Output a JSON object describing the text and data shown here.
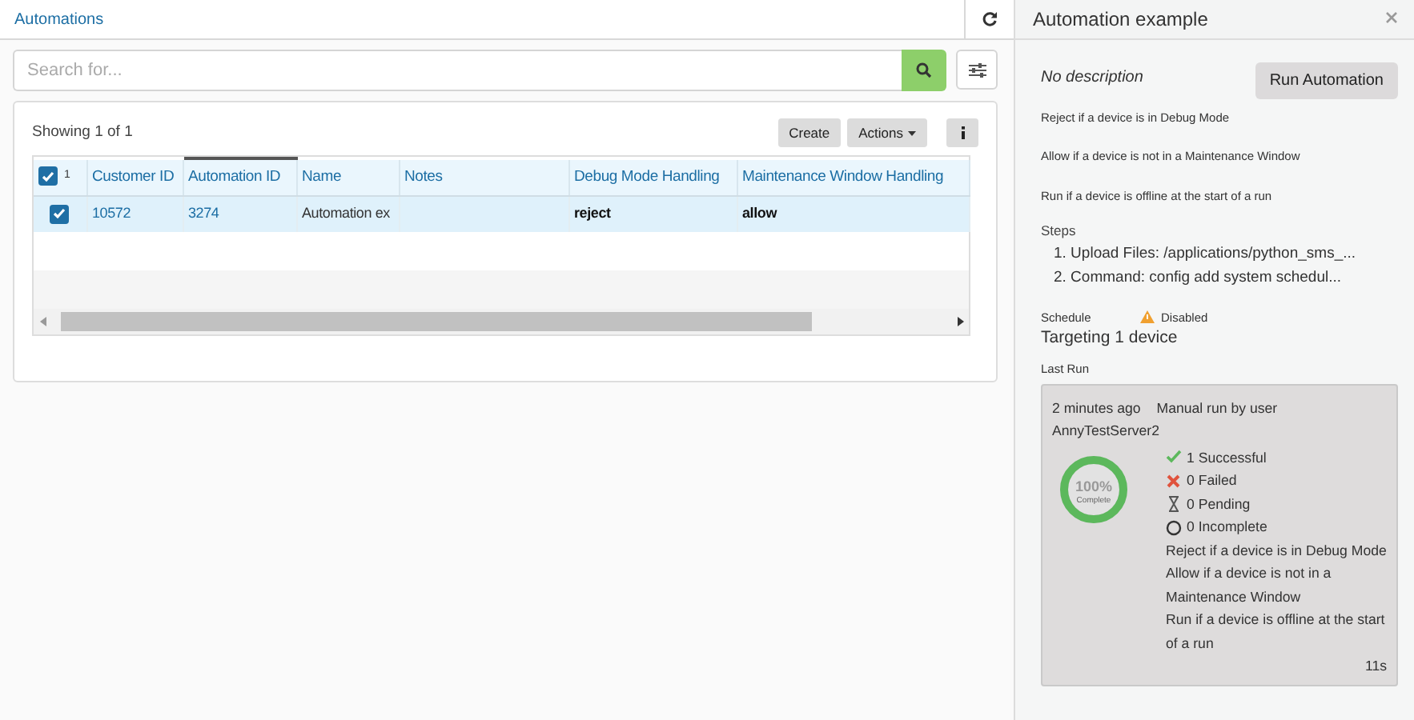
{
  "breadcrumb": "Automations",
  "search": {
    "placeholder": "Search for..."
  },
  "toolbar": {
    "showing": "Showing 1 of 1",
    "create": "Create",
    "actions": "Actions"
  },
  "table": {
    "select_all": {
      "checked": true,
      "count": "1"
    },
    "columns": [
      {
        "label": "Customer ID",
        "sorted": false
      },
      {
        "label": "Automation ID",
        "sorted": true
      },
      {
        "label": "Name",
        "sorted": false
      },
      {
        "label": "Notes",
        "sorted": false
      },
      {
        "label": "Debug Mode Handling",
        "sorted": false
      },
      {
        "label": "Maintenance Window Handling",
        "sorted": false
      }
    ],
    "rows": [
      {
        "selected": true,
        "cells": [
          {
            "text": "10572",
            "kind": "link"
          },
          {
            "text": "3274",
            "kind": "link"
          },
          {
            "text": "Automation ex",
            "kind": "plain"
          },
          {
            "text": "",
            "kind": "plain"
          },
          {
            "text": "reject",
            "kind": "strong"
          },
          {
            "text": "allow",
            "kind": "strong"
          }
        ]
      }
    ]
  },
  "detail": {
    "title": "Automation example",
    "description": "No description",
    "run_button": "Run Automation",
    "rules": [
      "Reject if a device is in Debug Mode",
      "Allow if a device is not in a Maintenance Window",
      "Run if a device is offline at the start of a run"
    ],
    "steps_label": "Steps",
    "steps": [
      "1. Upload Files: /applications/python_sms_...",
      "2. Command: config add system schedul..."
    ],
    "schedule_label": "Schedule",
    "schedule_status": "Disabled",
    "targeting": "Targeting 1 device",
    "last_run_label": "Last Run",
    "last_run": {
      "when": "2 minutes ago",
      "trigger": "Manual run by user",
      "server": "AnnyTestServer2",
      "percent": "100%",
      "complete_label": "Complete",
      "level": 1,
      "results": [
        {
          "kind": "success",
          "text": "1 Successful"
        },
        {
          "kind": "failed",
          "text": "0 Failed"
        },
        {
          "kind": "pending",
          "text": "0 Pending"
        },
        {
          "kind": "incomplete",
          "text": "0 Incomplete"
        }
      ],
      "rules": [
        "Reject if a device is in Debug Mode",
        "Allow if a device is not in a Maintenance Window",
        "Run if a device is offline at the start of a run"
      ],
      "duration": "11s"
    }
  }
}
